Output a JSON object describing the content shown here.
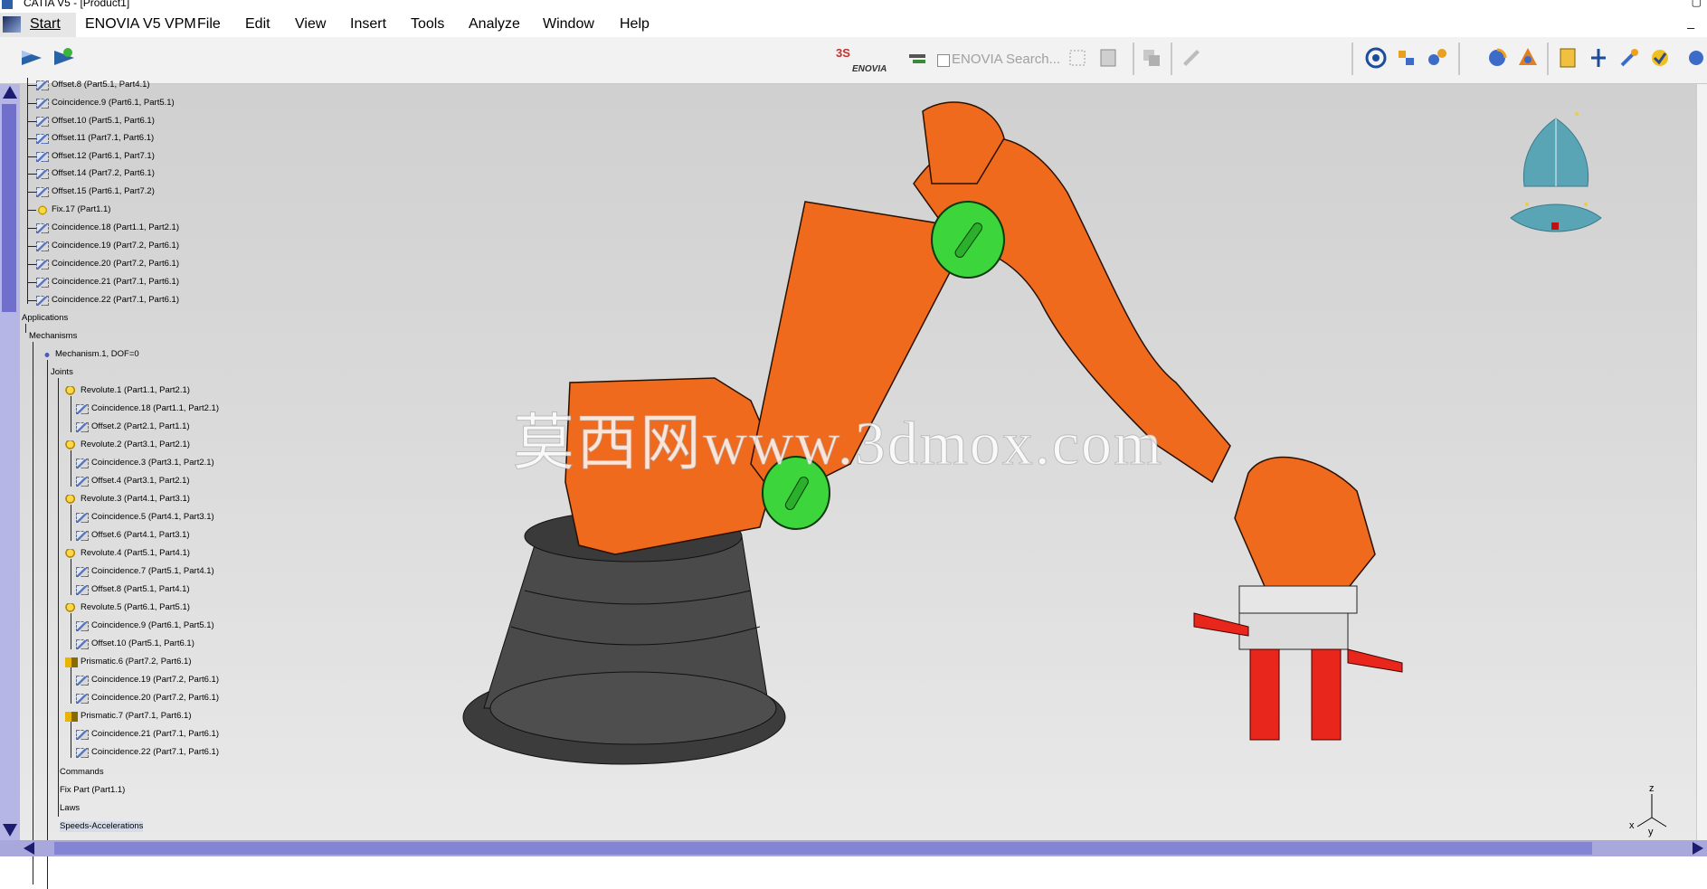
{
  "window": {
    "title": "CATIA V5 - [Product1]"
  },
  "menu": {
    "start": "Start",
    "items": [
      "ENOVIA V5 VPM",
      "File",
      "Edit",
      "View",
      "Insert",
      "Tools",
      "Analyze",
      "Window",
      "Help"
    ]
  },
  "toolbar": {
    "enovia_label": "ENOVIA",
    "enovia_search_placeholder": "ENOVIA Search..."
  },
  "tree": {
    "constraints": [
      "Offset.8 (Part5.1, Part4.1)",
      "Coincidence.9 (Part6.1, Part5.1)",
      "Offset.10 (Part5.1, Part6.1)",
      "Offset.11 (Part7.1, Part6.1)",
      "Offset.12 (Part6.1, Part7.1)",
      "Offset.14 (Part7.2, Part6.1)",
      "Offset.15 (Part6.1, Part7.2)",
      "Fix.17 (Part1.1)",
      "Coincidence.18 (Part1.1, Part2.1)",
      "Coincidence.19 (Part7.2, Part6.1)",
      "Coincidence.20 (Part7.2, Part6.1)",
      "Coincidence.21 (Part7.1, Part6.1)",
      "Coincidence.22 (Part7.1, Part6.1)"
    ],
    "applications": "Applications",
    "mechanisms": "Mechanisms",
    "mechanism": "Mechanism.1, DOF=0",
    "joints_label": "Joints",
    "joints": [
      {
        "name": "Revolute.1 (Part1.1, Part2.1)",
        "kind": "revolute",
        "children": [
          "Coincidence.18 (Part1.1, Part2.1)",
          "Offset.2 (Part2.1, Part1.1)"
        ]
      },
      {
        "name": "Revolute.2 (Part3.1, Part2.1)",
        "kind": "revolute",
        "children": [
          "Coincidence.3 (Part3.1, Part2.1)",
          "Offset.4 (Part3.1, Part2.1)"
        ]
      },
      {
        "name": "Revolute.3 (Part4.1, Part3.1)",
        "kind": "revolute",
        "children": [
          "Coincidence.5 (Part4.1, Part3.1)",
          "Offset.6 (Part4.1, Part3.1)"
        ]
      },
      {
        "name": "Revolute.4 (Part5.1, Part4.1)",
        "kind": "revolute",
        "children": [
          "Coincidence.7 (Part5.1, Part4.1)",
          "Offset.8 (Part5.1, Part4.1)"
        ]
      },
      {
        "name": "Revolute.5 (Part6.1, Part5.1)",
        "kind": "revolute",
        "children": [
          "Coincidence.9 (Part6.1, Part5.1)",
          "Offset.10 (Part5.1, Part6.1)"
        ]
      },
      {
        "name": "Prismatic.6 (Part7.2, Part6.1)",
        "kind": "prismatic",
        "children": [
          "Coincidence.19 (Part7.2, Part6.1)",
          "Coincidence.20 (Part7.2, Part6.1)"
        ]
      },
      {
        "name": "Prismatic.7 (Part7.1, Part6.1)",
        "kind": "prismatic",
        "children": [
          "Coincidence.21 (Part7.1, Part6.1)",
          "Coincidence.22 (Part7.1, Part6.1)"
        ]
      }
    ],
    "commands": "Commands",
    "fix_part": "Fix Part (Part1.1)",
    "laws": "Laws",
    "speeds": "Speeds-Accelerations"
  },
  "viewport": {
    "watermark": "莫西网www.3dmox.com",
    "axis_z": "z",
    "axis_x": "x",
    "axis_y": "y"
  },
  "colors": {
    "robot": "#f06a1e",
    "base": "#4a4a4a",
    "cap": "#3cd63c",
    "gripper": "#e8261c"
  }
}
